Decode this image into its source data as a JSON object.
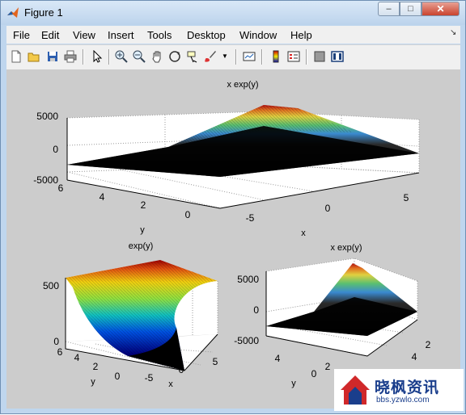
{
  "window": {
    "title": "Figure 1",
    "minimize": "–",
    "maximize": "□",
    "close": "✕"
  },
  "menu": [
    "File",
    "Edit",
    "View",
    "Insert",
    "Tools",
    "Desktop",
    "Window",
    "Help"
  ],
  "toolbar_icons": [
    "new-figure-icon",
    "open-icon",
    "save-icon",
    "print-icon",
    "pointer-icon",
    "zoom-in-icon",
    "zoom-out-icon",
    "pan-icon",
    "rotate-icon",
    "data-cursor-icon",
    "brush-icon",
    "brush-dropdown-icon",
    "link-plot-icon",
    "colorbar-icon",
    "legend-icon",
    "hide-plot-tools-icon",
    "show-plot-tools-icon"
  ],
  "plots": {
    "top": {
      "title": "x exp(y)",
      "xlabel": "x",
      "ylabel": "y",
      "z_ticks": [
        "5000",
        "0",
        "-5000"
      ],
      "x_ticks": [
        "-5",
        "0",
        "5"
      ],
      "y_ticks": [
        "0",
        "2",
        "4",
        "6"
      ]
    },
    "bottom_left": {
      "title": "exp(y)",
      "xlabel": "x",
      "ylabel": "y",
      "z_ticks": [
        "500",
        "0"
      ],
      "x_ticks": [
        "-5",
        "0",
        "5"
      ],
      "y_ticks": [
        "0",
        "2",
        "4",
        "6"
      ]
    },
    "bottom_right": {
      "title": "x exp(y)",
      "xlabel": "",
      "ylabel": "y",
      "z_ticks": [
        "5000",
        "0",
        "-5000"
      ],
      "x_ticks": [
        "0",
        "2",
        "4"
      ],
      "y_ticks": [
        "4",
        "2"
      ]
    }
  },
  "watermark": {
    "name": "晓枫资讯",
    "url": "bbs.yzwlo.com"
  }
}
